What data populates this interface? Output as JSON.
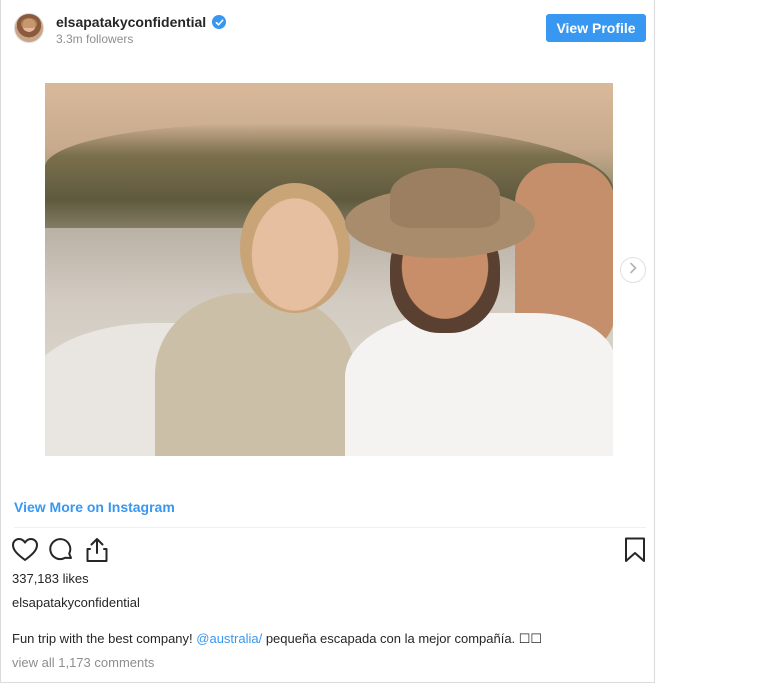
{
  "header": {
    "username": "elsapatakyconfidential",
    "followers": "3.3m followers",
    "view_profile_label": "View Profile"
  },
  "links": {
    "view_more": "View More on Instagram"
  },
  "post": {
    "likes": "337,183 likes",
    "caption_user": "elsapatakyconfidential",
    "caption_text_before": "Fun trip with the best company! ",
    "caption_mention": "@australia/",
    "caption_text_after": " pequeña escapada con la mejor compañía. ☐☐",
    "comments_link": "view all 1,173 comments"
  },
  "icons": {
    "verified": "verified-badge-icon",
    "next": "chevron-right-icon",
    "like": "heart-icon",
    "comment": "comment-icon",
    "share": "share-icon",
    "save": "bookmark-icon"
  },
  "colors": {
    "accent": "#3897f0",
    "text": "#262626",
    "muted": "#8e8e8e"
  }
}
